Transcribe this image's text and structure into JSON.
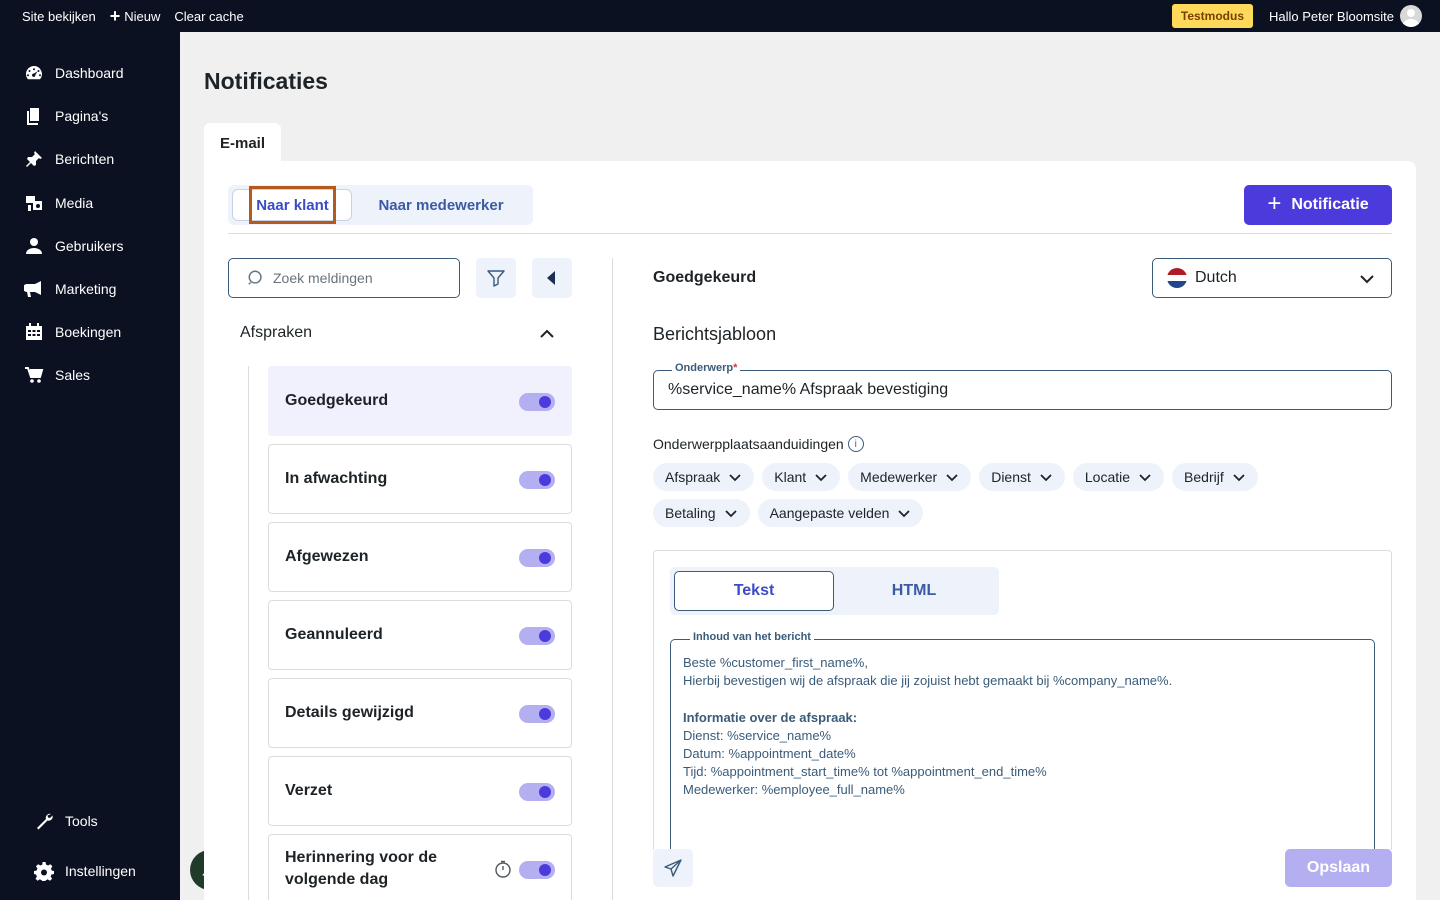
{
  "topbar": {
    "site_link": "Site bekijken",
    "new_label": "Nieuw",
    "clear_cache": "Clear cache",
    "test_badge": "Testmodus",
    "greeting": "Hallo Peter Bloomsite"
  },
  "sidebar": {
    "items": [
      {
        "label": "Dashboard",
        "icon": "dashboard-icon"
      },
      {
        "label": "Pagina's",
        "icon": "pages-icon"
      },
      {
        "label": "Berichten",
        "icon": "pin-icon"
      },
      {
        "label": "Media",
        "icon": "media-icon"
      },
      {
        "label": "Gebruikers",
        "icon": "user-icon"
      },
      {
        "label": "Marketing",
        "icon": "megaphone-icon"
      },
      {
        "label": "Boekingen",
        "icon": "calendar-icon"
      },
      {
        "label": "Sales",
        "icon": "cart-icon"
      }
    ],
    "bottom_items": [
      {
        "label": "Tools",
        "icon": "wrench-icon"
      },
      {
        "label": "Instellingen",
        "icon": "gear-icon"
      }
    ]
  },
  "page": {
    "title": "Notificaties",
    "tab": "E-mail"
  },
  "recipient_tabs": {
    "customer": "Naar klant",
    "employee": "Naar medewerker"
  },
  "new_button": "Notificatie",
  "list": {
    "search_placeholder": "Zoek meldingen",
    "group": "Afspraken",
    "items": [
      {
        "label": "Goedgekeurd",
        "active": true,
        "enabled": true
      },
      {
        "label": "In afwachting",
        "active": false,
        "enabled": true
      },
      {
        "label": "Afgewezen",
        "active": false,
        "enabled": true
      },
      {
        "label": "Geannuleerd",
        "active": false,
        "enabled": true
      },
      {
        "label": "Details gewijzigd",
        "active": false,
        "enabled": true
      },
      {
        "label": "Verzet",
        "active": false,
        "enabled": true
      },
      {
        "label": "Herinnering voor de volgende dag",
        "active": false,
        "enabled": true,
        "timer": true
      }
    ]
  },
  "detail": {
    "title": "Goedgekeurd",
    "language": "Dutch",
    "section_title": "Berichtsjabloon",
    "subject_label": "Onderwerp",
    "subject_value": "%service_name% Afspraak bevestiging",
    "placeholders_label": "Onderwerpplaatsaanduidingen",
    "placeholder_chips": [
      "Afspraak",
      "Klant",
      "Medewerker",
      "Dienst",
      "Locatie",
      "Bedrijf",
      "Betaling",
      "Aangepaste velden"
    ],
    "editor_tabs": {
      "text": "Tekst",
      "html": "HTML"
    },
    "body_label": "Inhoud van het bericht",
    "body_lines": [
      {
        "text": "Beste %customer_first_name%,",
        "bold": false
      },
      {
        "text": "Hierbij bevestigen wij de afspraak die jij zojuist hebt gemaakt bij %company_name%.",
        "bold": false
      },
      {
        "text": " ",
        "bold": false
      },
      {
        "text": "Informatie over de afspraak:",
        "bold": true
      },
      {
        "text": "Dienst: %service_name%",
        "bold": false
      },
      {
        "text": "Datum: %appointment_date%",
        "bold": false
      },
      {
        "text": "Tijd: %appointment_start_time% tot %appointment_end_time%",
        "bold": false
      },
      {
        "text": "Medewerker: %employee_full_name%",
        "bold": false
      }
    ],
    "save_label": "Opslaan"
  },
  "colors": {
    "sidebar_bg": "#0c1121",
    "accent": "#4c3bdc",
    "accent_light": "#b4aff0",
    "test_badge_bg": "#ffd95a"
  }
}
